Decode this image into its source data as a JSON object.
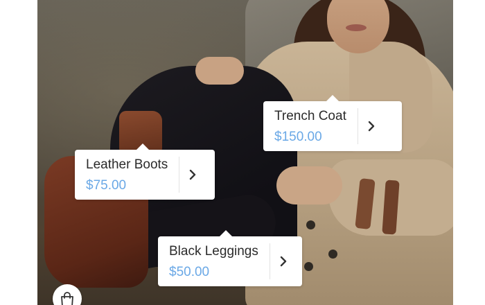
{
  "products": [
    {
      "name": "Trench Coat",
      "price": "$150.00",
      "icon": "chevron-right-icon"
    },
    {
      "name": "Leather Boots",
      "price": "$75.00",
      "icon": "chevron-right-icon"
    },
    {
      "name": "Black Leggings",
      "price": "$50.00",
      "icon": "chevron-right-icon"
    }
  ],
  "bag_button": {
    "icon": "shopping-bag-icon"
  },
  "colors": {
    "price": "#6aa8e6",
    "product_name": "#2b2b2b",
    "card_background": "#ffffff"
  }
}
